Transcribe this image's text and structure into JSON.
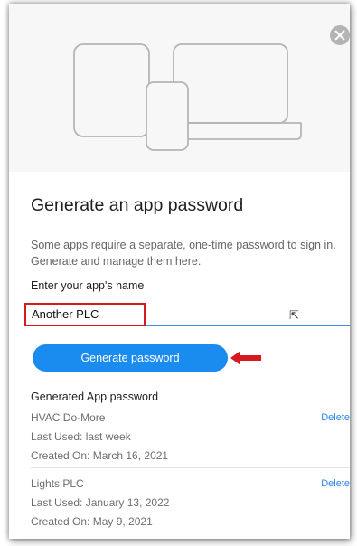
{
  "dialog": {
    "close_icon": "close-circle-icon",
    "hero_icon": "devices-illustration",
    "title": "Generate an app password",
    "description": "Some apps require a separate, one-time password to sign in. Generate and manage them here.",
    "name_field": {
      "label": "Enter your app's name",
      "value": "Another PLC"
    },
    "generate_button": "Generate password",
    "generated_title": "Generated App password",
    "passwords": [
      {
        "name": "HVAC Do-More",
        "last_used": "Last Used: last week",
        "created": "Created On: March 16, 2021",
        "delete_label": "Delete"
      },
      {
        "name": "Lights PLC",
        "last_used": "Last Used: January 13, 2022",
        "created": "Created On: May 9, 2021",
        "delete_label": "Delete"
      }
    ]
  },
  "colors": {
    "accent": "#1a8cf0",
    "annotation_red": "#d71920",
    "link": "#2f86e6"
  }
}
